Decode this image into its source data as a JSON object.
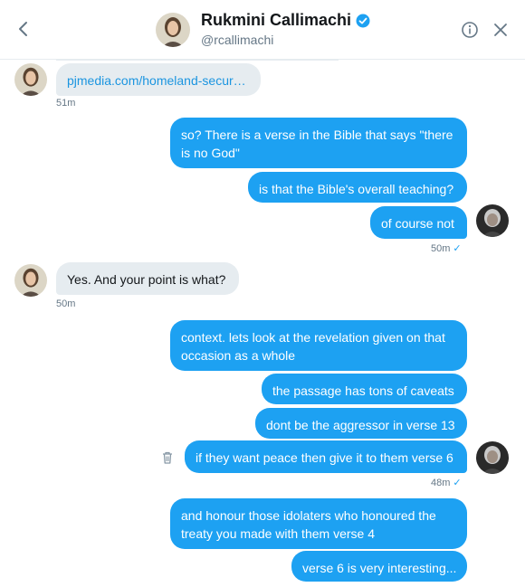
{
  "header": {
    "name": "Rukmini Callimachi",
    "handle": "@rcallimachi",
    "back_icon": "chevron-left-icon",
    "info_icon": "info-icon",
    "close_icon": "close-icon",
    "verified_icon": "verified-badge-icon"
  },
  "colors": {
    "accent": "#1da1f2",
    "incoming_bubble": "#e6ecf0",
    "timestamp": "#657786"
  },
  "messages": [
    {
      "dir": "in",
      "text": "pjmedia.com/homeland-secur…",
      "link": true
    },
    {
      "ts": "51m"
    },
    {
      "dir": "out",
      "text": "so? There is a verse in the Bible that says \"there is no God\""
    },
    {
      "dir": "out",
      "text": "is that the Bible's overall teaching?"
    },
    {
      "dir": "out",
      "text": "of course not"
    },
    {
      "ts": "50m",
      "read": true
    },
    {
      "dir": "in",
      "text": "Yes. And your point is what?"
    },
    {
      "ts": "50m"
    },
    {
      "dir": "out",
      "text": "context. lets look at the revelation given on that occasion as a whole"
    },
    {
      "dir": "out",
      "text": "the passage has tons of caveats"
    },
    {
      "dir": "out",
      "text": "dont be the aggressor in verse 13"
    },
    {
      "dir": "out",
      "text": "if they want peace then give it to them verse 6"
    },
    {
      "ts": "48m",
      "read": true
    },
    {
      "dir": "out",
      "text": "and honour those idolaters who honoured the treaty you made with them verse 4"
    },
    {
      "dir": "out",
      "text": "verse 6 is very interesting..."
    }
  ],
  "thread": {
    "m1": "pjmedia.com/homeland-secur…",
    "t1": "51m",
    "m2a": "so? There is a verse in the Bible that says \"there",
    "m2b": "is no God\"",
    "m3": "is that the Bible's overall teaching?",
    "m4": "of course not",
    "t2": "50m",
    "m5": "Yes. And your point is what?",
    "t3": "50m",
    "m6a": "context. lets look at the revelation given on that",
    "m6b": "occasion as a whole",
    "m7": "the passage has tons of caveats",
    "m8": "dont be the aggressor in verse 13",
    "m9": "if they want peace then give it to them verse 6",
    "t4": "48m",
    "m10a": "and honour those idolaters who honoured the",
    "m10b": "treaty you made with them verse 4",
    "m11": "verse 6 is very interesting...",
    "read_mark": "✓"
  },
  "icons": {
    "trash": "trash-icon"
  }
}
